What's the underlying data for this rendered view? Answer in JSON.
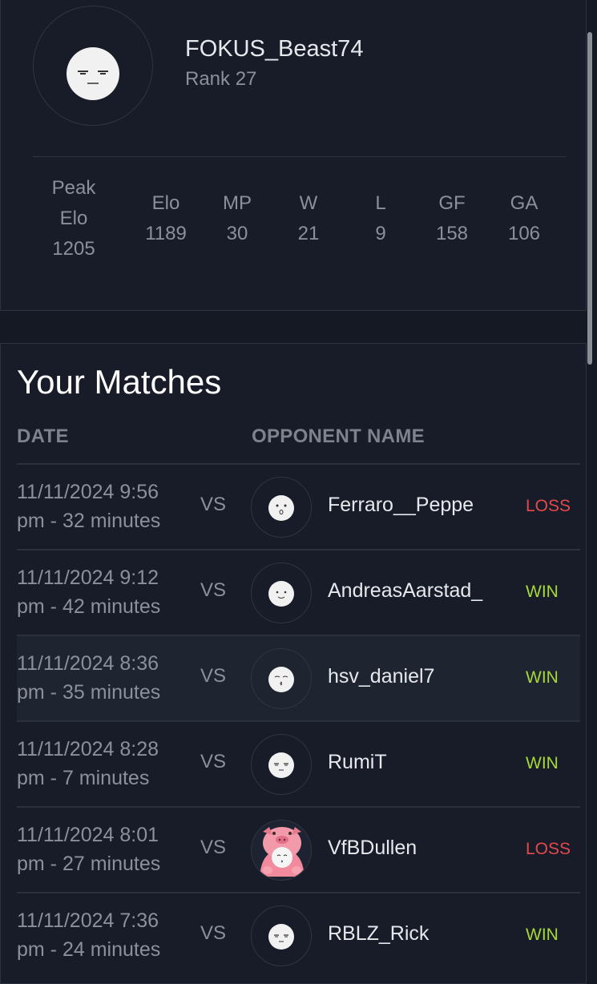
{
  "profile": {
    "username": "FOKUS_Beast74",
    "rank": "Rank 27",
    "avatar": "neutral-face-icon",
    "stats": [
      {
        "label": "Peak Elo",
        "value": "1205"
      },
      {
        "label": "Elo",
        "value": "1189"
      },
      {
        "label": "MP",
        "value": "30"
      },
      {
        "label": "W",
        "value": "21"
      },
      {
        "label": "L",
        "value": "9"
      },
      {
        "label": "GF",
        "value": "158"
      },
      {
        "label": "GA",
        "value": "106"
      }
    ]
  },
  "matches": {
    "title": "Your Matches",
    "columns": {
      "date": "DATE",
      "opponent": "OPPONENT NAME"
    },
    "vs_label": "VS",
    "rows": [
      {
        "date_line1": "11/11/2024 9:56",
        "date_line2": "pm - 32 minutes",
        "opponent": "Ferraro__Peppe",
        "result": "LOSS",
        "avatar": "surprised-face-icon"
      },
      {
        "date_line1": "11/11/2024 9:12",
        "date_line2": "pm - 42 minutes",
        "opponent": "AndreasAarstad_",
        "result": "WIN",
        "avatar": "smile-face-icon"
      },
      {
        "date_line1": "11/11/2024 8:36",
        "date_line2": "pm - 35 minutes",
        "opponent": "hsv_daniel7",
        "result": "WIN",
        "avatar": "kiss-face-icon"
      },
      {
        "date_line1": "11/11/2024 8:28",
        "date_line2": "pm - 7 minutes",
        "opponent": "RumiT",
        "result": "WIN",
        "avatar": "neutral-face-icon"
      },
      {
        "date_line1": "11/11/2024 8:01",
        "date_line2": "pm - 27 minutes",
        "opponent": "VfBDullen",
        "result": "LOSS",
        "avatar": "pig-costume-icon"
      },
      {
        "date_line1": "11/11/2024 7:36",
        "date_line2": "pm - 24 minutes",
        "opponent": "RBLZ_Rick",
        "result": "WIN",
        "avatar": "neutral-face-icon"
      }
    ]
  },
  "colors": {
    "background": "#141924",
    "loss": "#e5484d",
    "win": "#a6d937"
  }
}
